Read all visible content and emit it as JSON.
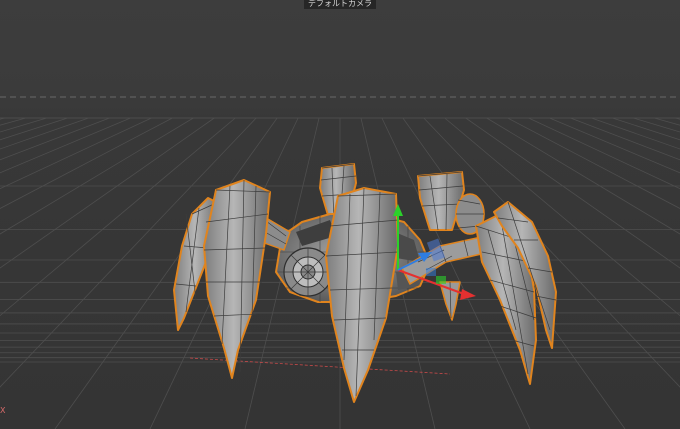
{
  "viewport": {
    "camera_label": "デフォルトカメラ",
    "axis_label": "X",
    "colors": {
      "background": "#3a3a3a",
      "grid": "#505050",
      "selection_outline": "#e0841e",
      "mesh_fill": "#9a9a9a",
      "mesh_wire": "#3c3c3c",
      "axis_x": "#e53030",
      "axis_y": "#2bd12b",
      "axis_z": "#2f7de0"
    }
  }
}
